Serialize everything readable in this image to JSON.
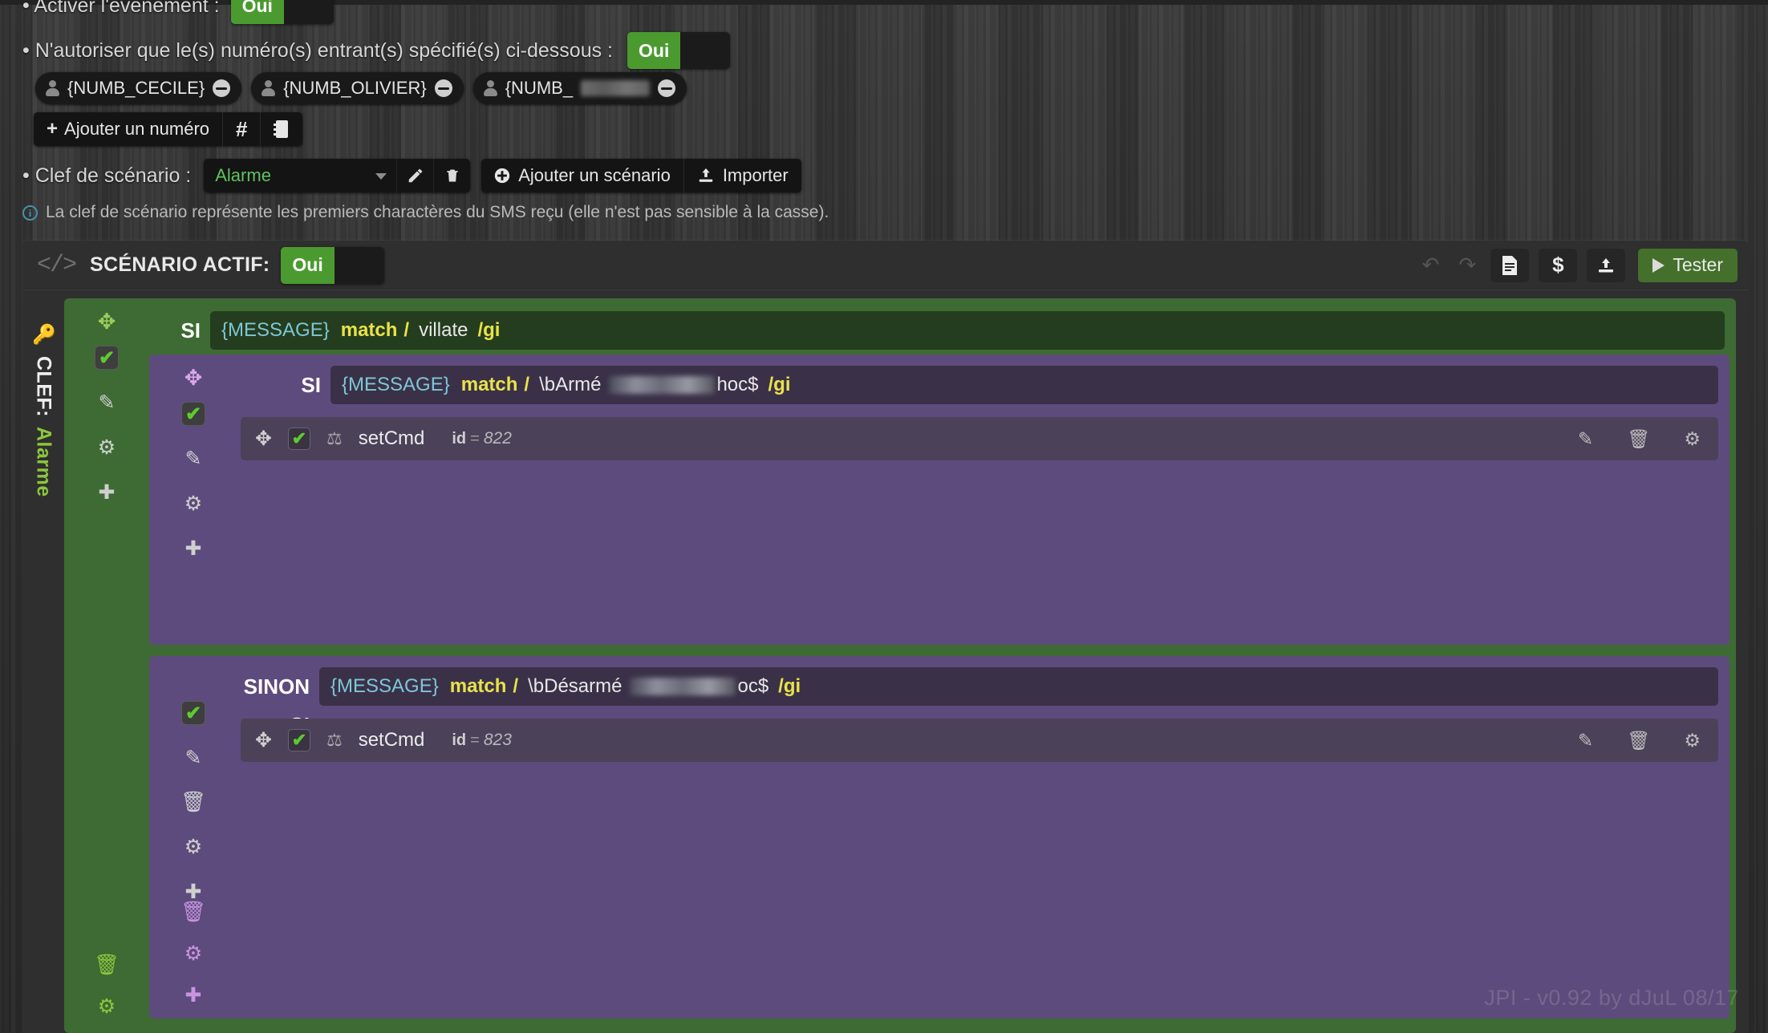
{
  "form": {
    "activer_event": {
      "label": "• Activer l'événement :",
      "toggle_on_label": "Oui"
    },
    "autoriser": {
      "label": "• N'autoriser que le(s) numéro(s) entrant(s) spécifié(s) ci-dessous :",
      "toggle_on_label": "Oui"
    },
    "numbers": [
      {
        "label": "{NUMB_CECILE}",
        "redacted": false
      },
      {
        "label": "{NUMB_OLIVIER}",
        "redacted": false
      },
      {
        "label": "{NUMB_",
        "redacted": true
      }
    ],
    "add_number_button": "Ajouter un numéro",
    "hash_button": "#",
    "book_button": "book-icon",
    "clef": {
      "label": "• Clef de scénario :",
      "selected": "Alarme",
      "edit_icon": "pencil-icon",
      "delete_icon": "trash-icon",
      "add_scenario_button": "Ajouter un scénario",
      "import_button": "Importer"
    },
    "info_text": "La clef de scénario représente les premiers charactères du SMS reçu (elle n'est pas sensible à la casse).",
    "info_badge": "i"
  },
  "scenario": {
    "header": {
      "code_icon": "</>",
      "title": "SCÉNARIO ACTIF:",
      "toggle_on_label": "Oui",
      "undo_icon": "undo-icon",
      "redo_icon": "redo-icon",
      "doc_button": "document-icon",
      "var_button": "$",
      "export_button": "upload-icon",
      "test_button": "Tester"
    },
    "rail": {
      "key_icon": "key-icon",
      "label": "CLEF:",
      "value": "Alarme"
    },
    "green_block": {
      "move_handle": "move-icon",
      "si_word": "SI",
      "condition": {
        "variable": "{MESSAGE}",
        "func": "match",
        "slash": "/",
        "pattern": "villate",
        "flags": "/gi"
      },
      "rail_icons": [
        "check-icon",
        "pencil-icon",
        "gear-icon",
        "plus-circle-icon"
      ],
      "bottom_icons": [
        "trash-icon",
        "gear-icon"
      ]
    },
    "purple_si": {
      "move_handle": "move-icon",
      "si_word": "SI",
      "condition": {
        "variable": "{MESSAGE}",
        "func": "match",
        "slash": "/",
        "pattern_prefix": "\\bArmé",
        "pattern_redacted": true,
        "pattern_suffix": "hoc$",
        "flags": "/gi"
      },
      "rail_icons": [
        "check-icon",
        "pencil-icon",
        "gear-icon",
        "plus-circle-icon"
      ],
      "action": {
        "move_handle": "move-icon",
        "enabled": true,
        "type_icon": "scenario-icon",
        "name": "setCmd",
        "id_key": "id",
        "id_eq": "=",
        "id_value": "822",
        "right_icons": [
          "pencil-icon",
          "trash-icon",
          "gear-icon"
        ]
      }
    },
    "purple_sinon": {
      "si_word": "SINON SI",
      "condition": {
        "variable": "{MESSAGE}",
        "func": "match",
        "slash": "/",
        "pattern_prefix": "\\bDésarmé",
        "pattern_redacted": true,
        "pattern_suffix": "oc$",
        "flags": "/gi"
      },
      "rail_icons": [
        "check-icon",
        "pencil-icon",
        "trash-icon",
        "gear-icon",
        "plus-circle-icon"
      ],
      "bottom_icons": [
        "trash-icon",
        "gear-icon",
        "plus-circle-icon"
      ],
      "action": {
        "move_handle": "move-icon",
        "enabled": true,
        "type_icon": "scenario-icon",
        "name": "setCmd",
        "id_key": "id",
        "id_eq": "=",
        "id_value": "823",
        "right_icons": [
          "pencil-icon",
          "trash-icon",
          "gear-icon"
        ]
      }
    }
  },
  "watermark": "JPI - v0.92 by dJuL 08/17",
  "colors": {
    "green_accent": "#4b9a30",
    "green_block": "#3d6b33",
    "purple_block": "#5e4b7d",
    "yellow_token": "#e9e24a",
    "cyan_token": "#7fc6d6",
    "link_green": "#5fc35f"
  }
}
